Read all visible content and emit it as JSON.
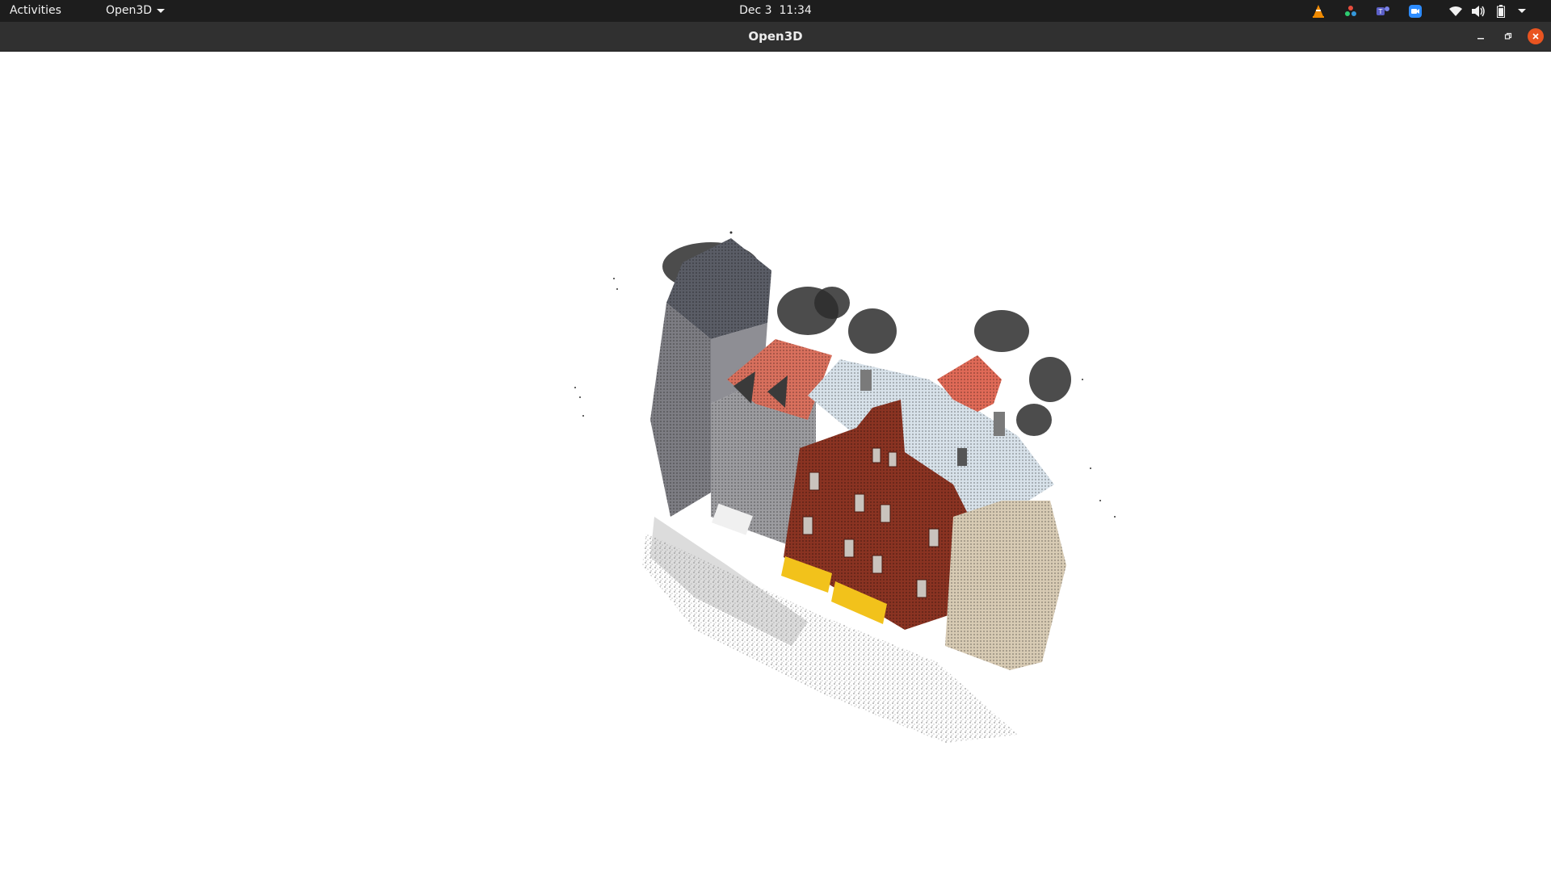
{
  "topbar": {
    "activities_label": "Activities",
    "app_menu_label": "Open3D",
    "clock_text": "Dec 3  11:34",
    "tray_icons": [
      "vlc-icon",
      "color-picker-icon",
      "teams-icon",
      "zoom-icon",
      "wifi-icon",
      "volume-icon",
      "battery-icon",
      "system-menu-chevron-icon"
    ]
  },
  "window": {
    "title": "Open3D",
    "controls": [
      "minimize-icon",
      "restore-icon",
      "close-icon"
    ],
    "close_color": "#e95420"
  },
  "viewer": {
    "content": "3D colored point cloud of a row of townhouses",
    "background": "#ffffff",
    "colors": {
      "gray_tower": "#7d7d83",
      "slate_roof": "#5a5d66",
      "brick_facade": "#8a3322",
      "salmon_roof": "#d9705d",
      "snow_roof": "#d8e2ea",
      "cream_facade": "#d8cbb4",
      "yellow_sign": "#f2c21b",
      "dark_trees": "#2d2d2d"
    }
  }
}
